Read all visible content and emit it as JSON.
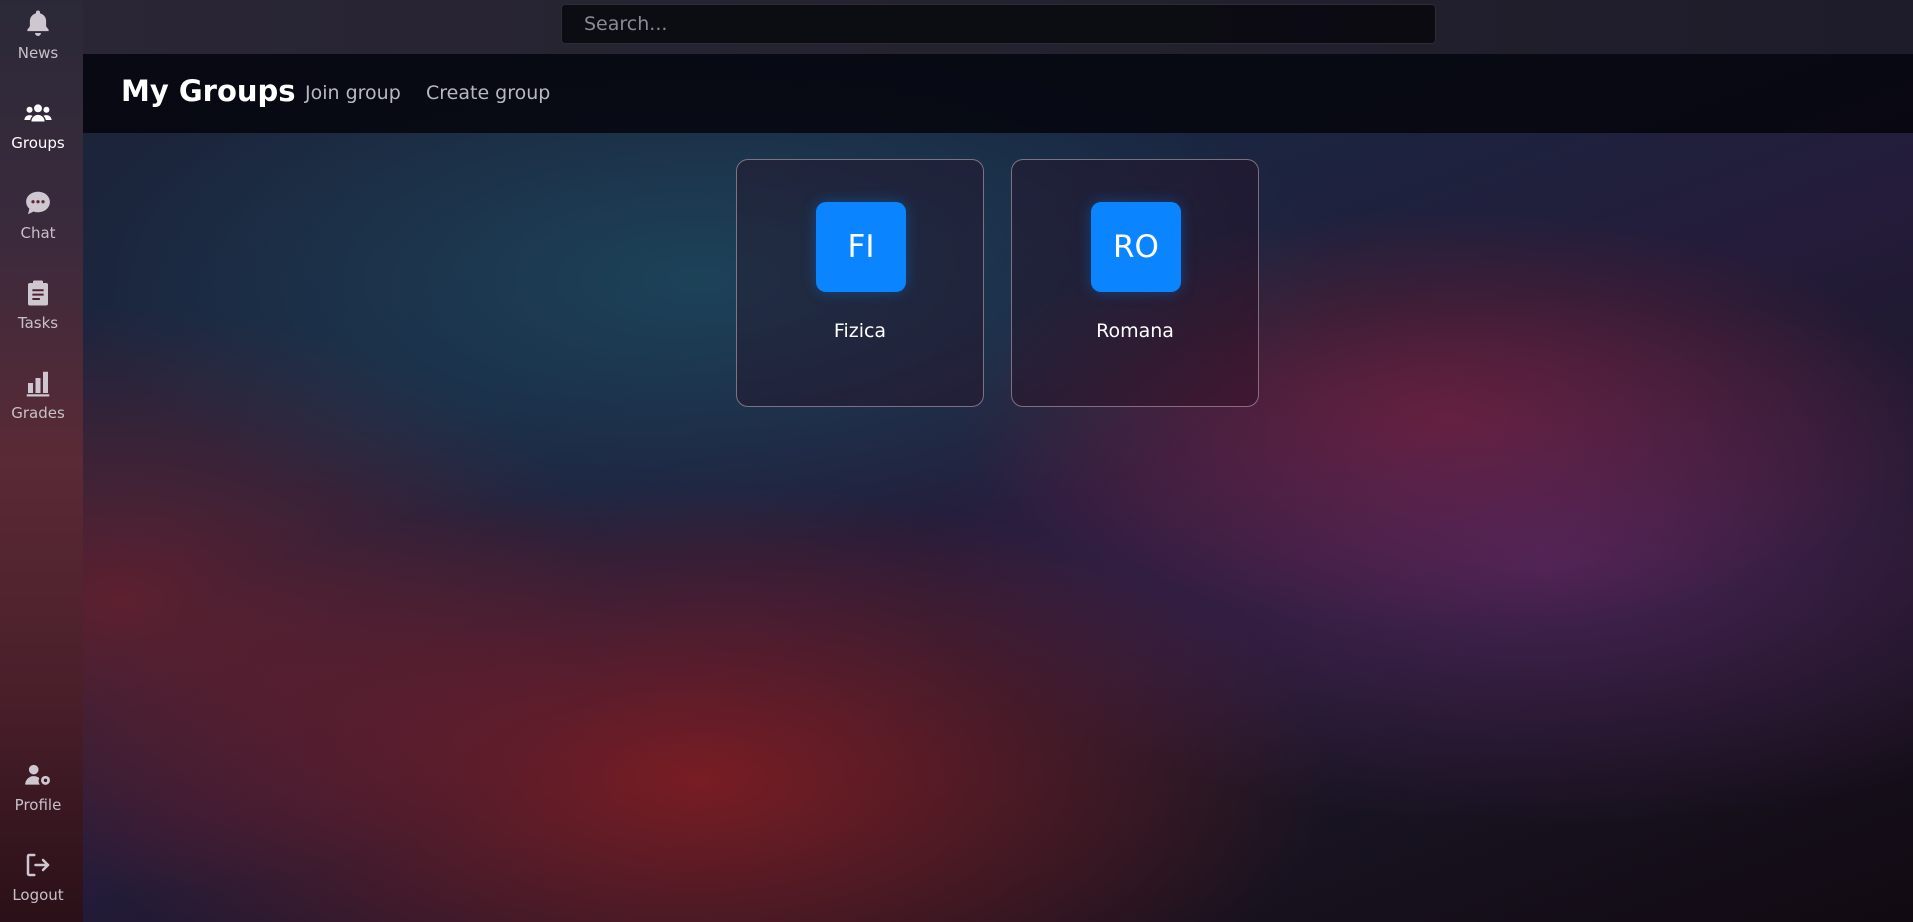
{
  "search": {
    "placeholder": "Search..."
  },
  "sidebar": {
    "top_items": [
      {
        "label": "News",
        "icon": "bell-icon"
      },
      {
        "label": "Groups",
        "icon": "users-icon",
        "active": true
      },
      {
        "label": "Chat",
        "icon": "chat-icon"
      },
      {
        "label": "Tasks",
        "icon": "clipboard-icon"
      },
      {
        "label": "Grades",
        "icon": "bar-chart-icon"
      }
    ],
    "bottom_items": [
      {
        "label": "Profile",
        "icon": "user-gear-icon"
      },
      {
        "label": "Logout",
        "icon": "logout-icon"
      }
    ]
  },
  "header": {
    "title": "My Groups",
    "links": [
      "Join group",
      "Create group"
    ]
  },
  "groups": [
    {
      "initials": "FI",
      "name": "Fizica"
    },
    {
      "initials": "RO",
      "name": "Romana"
    }
  ],
  "colors": {
    "badge": "#0a84ff",
    "header_bg": "#04040a"
  }
}
